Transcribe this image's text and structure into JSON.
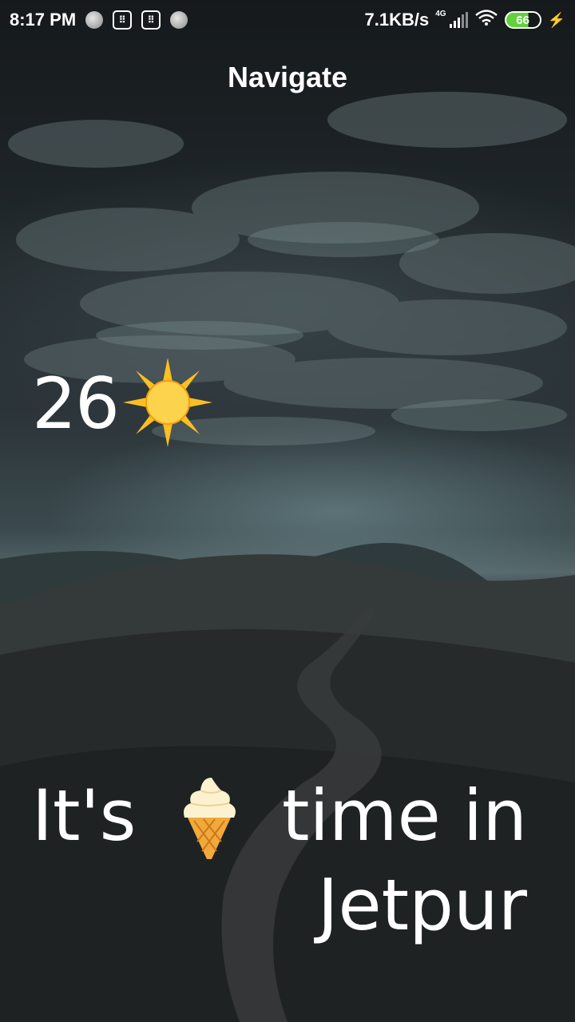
{
  "status_bar": {
    "time": "8:17 PM",
    "speed": "7.1KB/s",
    "network": "4G",
    "battery": "66",
    "icons": [
      "record-dot-icon",
      "sim-card-icon",
      "sim-card-icon",
      "record-dot-icon",
      "signal-icon",
      "wifi-icon",
      "battery-icon",
      "charging-bolt-icon"
    ]
  },
  "header": {
    "title": "Navigate"
  },
  "weather": {
    "temperature": "26",
    "condition_icon": "sun-icon"
  },
  "message": {
    "prefix": "It's",
    "food_icon": "ice-cream-icon",
    "suffix": "time in",
    "city": "Jetpur"
  },
  "colors": {
    "text": "#ffffff",
    "battery_fill": "#61d13c",
    "sun": "#fbbf24"
  }
}
